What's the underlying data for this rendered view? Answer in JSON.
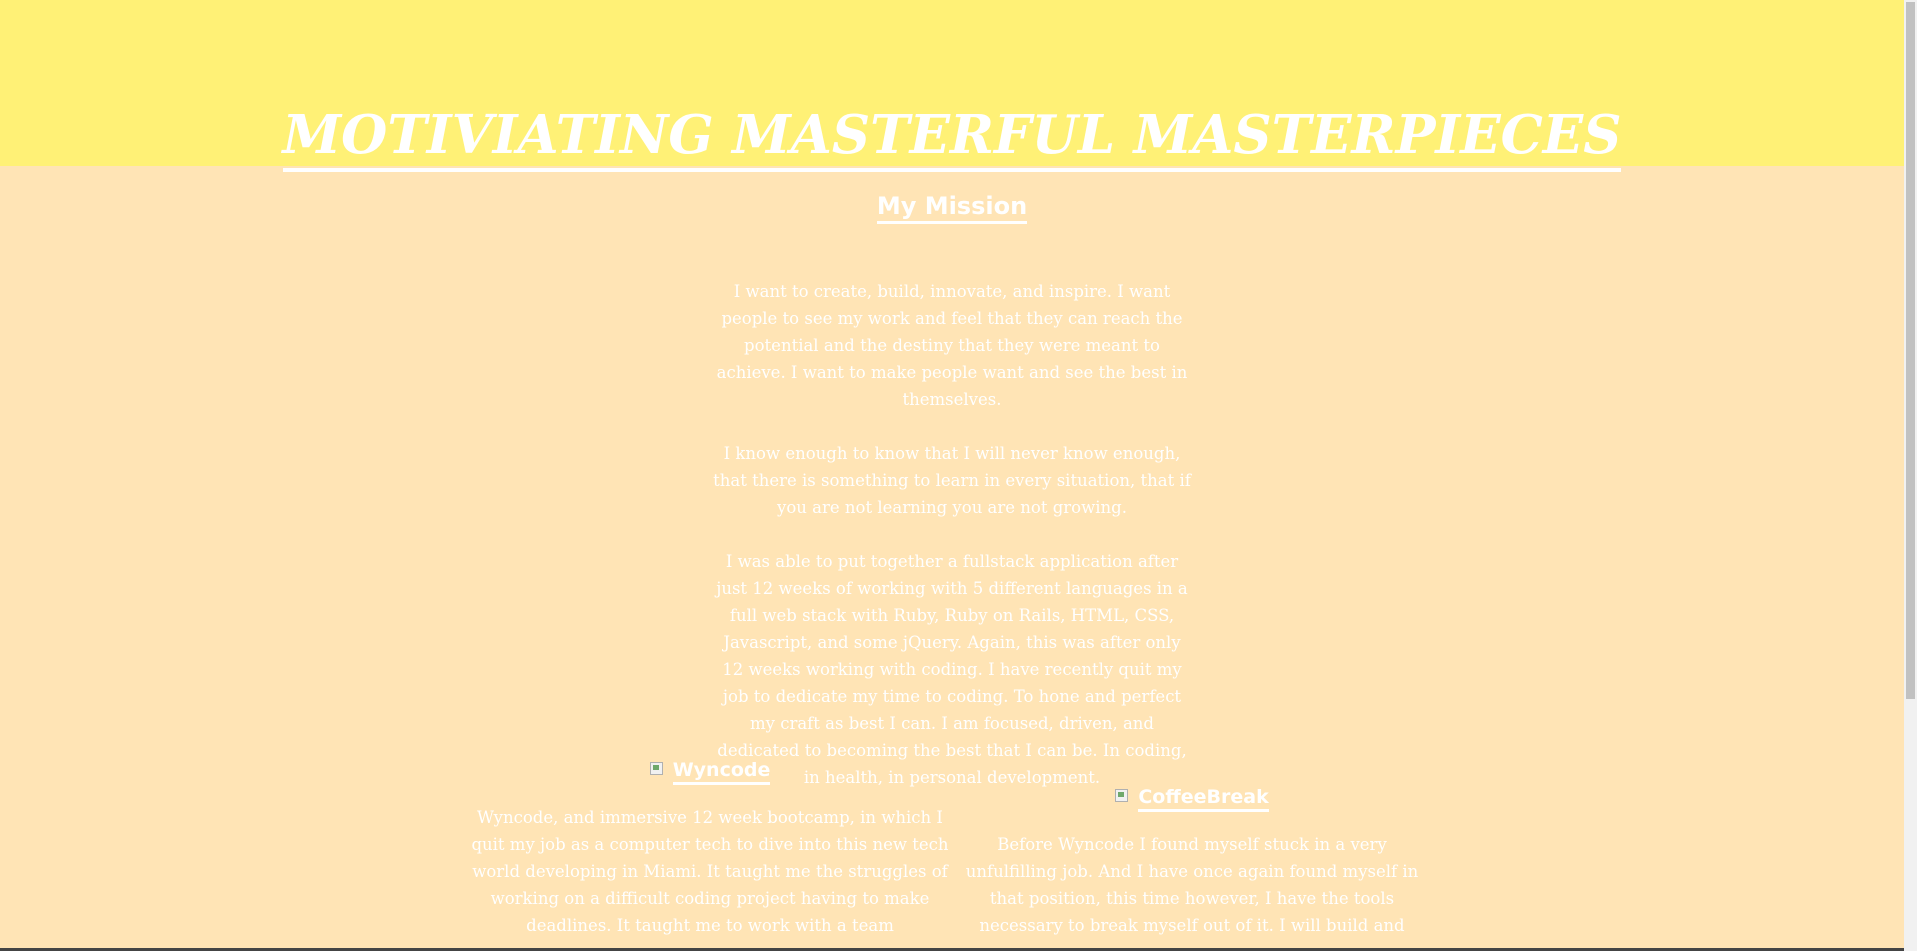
{
  "header": {
    "title": "MOTIVIATING MASTERFUL MASTERPIECES"
  },
  "mission": {
    "heading": "My Mission",
    "paragraphs": [
      "I want to create, build, innovate, and inspire. I want people to see my work and feel that they can reach the potential and the destiny that they were meant to achieve. I want to make people want and see the best in themselves.",
      "I know enough to know that I will never know enough, that there is something to learn in every situation, that if you are not learning you are not growing.",
      "I was able to put together a fullstack application after just 12 weeks of working with 5 different languages in a full web stack with Ruby, Ruby on Rails, HTML, CSS, Javascript, and some jQuery. Again, this was after only 12 weeks working with coding. I have recently quit my job to dedicate my time to coding. To hone and perfect my craft as best I can. I am focused, driven, and dedicated to becoming the best that I can be. In coding, in health, in personal development."
    ]
  },
  "projects": [
    {
      "name": "Wyncode",
      "description": "Wyncode, and immersive 12 week bootcamp, in which I quit my job as a computer tech to dive into this new tech world developing in Miami. It taught me the struggles of working on a difficult coding project having to make deadlines. It taught me to work with a team"
    },
    {
      "name": "CoffeeBreak",
      "description": "Before Wyncode I found myself stuck in a very unfulfilling job. And I have once again found myself in that position, this time however, I have the tools necessary to break myself out of it. I will build and"
    }
  ],
  "colors": {
    "header_background": "#fff176",
    "page_background": "#ffe4b5",
    "text": "#ffffff"
  }
}
